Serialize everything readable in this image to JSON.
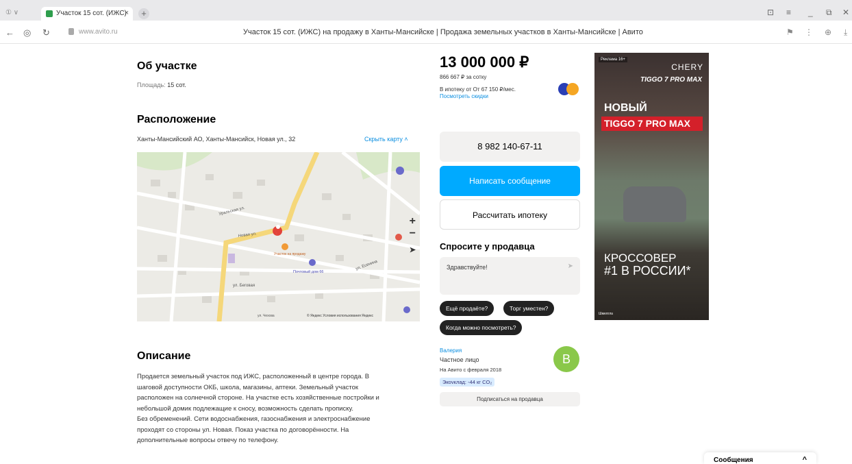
{
  "browser": {
    "tab_title": "Участок 15 сот. (ИЖС)",
    "tab_close": "×",
    "new_tab": "+",
    "url_host": "www.avito.ru",
    "page_title": "Участок 15 сот. (ИЖС) на продажу в Ханты-Мансийске | Продажа земельных участков в Ханты-Мансийске | Авито"
  },
  "about": {
    "heading": "Об участке",
    "area_label": "Площадь:",
    "area_value": "15 сот."
  },
  "location": {
    "heading": "Расположение",
    "address": "Ханты-Мансийский АО, Ханты-Мансийск, Новая ул., 32",
    "hide_map": "Скрыть карту ˄",
    "map": {
      "zoom_in": "+",
      "zoom_out": "−",
      "pin_label": "Участок на продажу",
      "footer": "© Яндекс Условия использования Яндекс",
      "street_labels": [
        "Новая ул.",
        "Уральская ул.",
        "ул. Беговая",
        "ул. Чехова",
        "ул. Есенина",
        "Почтовый дом 66"
      ]
    }
  },
  "description": {
    "heading": "Описание",
    "text_lines": [
      "Продается земельный участок под ИЖС, расположенный в центре города. В",
      "шаговой доступности ОКБ, школа, магазины, аптеки. Земельный участок",
      "расположен на солнечной стороне. На участке есть хозяйственные постройки и",
      "небольшой домик подлежащие к сносу, возможность сделать прописку.",
      "Без обременений. Сети водоснабжения, газоснабжения и электроснабжение",
      "проходят со стороны ул. Новая. Показ участка по договорённости. На",
      "дополнительные вопросы отвечу по телефону."
    ]
  },
  "pricing": {
    "price": "13 000 000 ₽",
    "per_sotka": "866 667 ₽ за сотку",
    "mortgage": "В ипотеку от От 67 150 ₽/мес.",
    "discounts_link": "Посмотреть скидки"
  },
  "contact": {
    "phone": "8 982 140-67-11",
    "write_message": "Написать сообщение",
    "calc_mortgage": "Рассчитать ипотеку",
    "ask_heading": "Спросите у продавца",
    "ask_placeholder": "Здравствуйте!",
    "chips": [
      "Ещё продаёте?",
      "Торг уместен?",
      "Когда можно посмотреть?"
    ]
  },
  "seller": {
    "name": "Валерия",
    "type": "Частное лицо",
    "since": "На Авито с февраля 2018",
    "eco": "Экovклад: -44 кг CO₂",
    "avatar_letter": "В",
    "subscribe": "Подписаться на продавца"
  },
  "ad": {
    "tag": "Реклама 16+",
    "brand": "CHERY",
    "model": "TIGGO 7 PRO MAX",
    "headline_new": "НОВЫЙ",
    "headline_model": "TIGGO 7 PRO MAX",
    "crossover_1": "КРОССОВЕР",
    "crossover_2": "#1 В РОССИИ*",
    "footer": "Шмелгла"
  },
  "messages_widget": {
    "label": "Сообщения",
    "chevron": "^"
  }
}
